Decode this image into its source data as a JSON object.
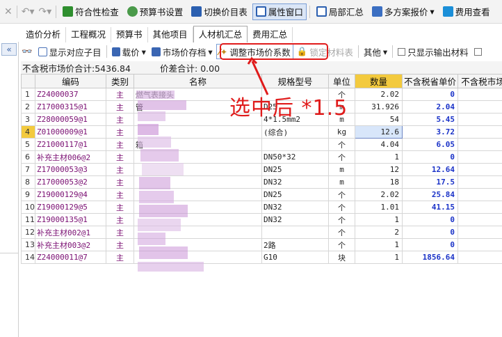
{
  "toolbar": {
    "items": [
      {
        "label": "符合性检查",
        "icon": "grid-check-icon",
        "color": "#2f8f2f"
      },
      {
        "label": "预算书设置",
        "icon": "gear-icon",
        "color": "#3a7a3a"
      },
      {
        "label": "切换价目表",
        "icon": "switch-icon",
        "color": "#2b5fb0"
      },
      {
        "label": "属性窗口",
        "icon": "window-icon",
        "color": "#2b5fb0",
        "active": true
      },
      {
        "label": "局部汇总",
        "icon": "summary-icon",
        "color": "#2b5fb0"
      },
      {
        "label": "多方案报价",
        "icon": "scheme-icon",
        "color": "#2b5fb0"
      },
      {
        "label": "费用查看",
        "icon": "cost-view-icon",
        "color": "#1b8fd8"
      }
    ]
  },
  "tabs": [
    "造价分析",
    "工程概况",
    "预算书",
    "其他项目",
    "人材机汇总",
    "费用汇总"
  ],
  "active_tab": "人材机汇总",
  "subtoolbar": {
    "show_child": "显示对应子目",
    "load_price": "载价",
    "market_price_file": "市场价存档",
    "adjust_coef": "调整市场价系数",
    "lock_material": "锁定材料表",
    "other": "其他",
    "only_output": "只显示输出材料"
  },
  "summary": {
    "label1": "不含税市场价合计:",
    "value1": "5436.84",
    "label2": "价差合计:",
    "value2": "0.00"
  },
  "columns": [
    "编码",
    "类别",
    "名称",
    "规格型号",
    "单位",
    "数量",
    "不含税省单价",
    "不含税市场"
  ],
  "rows": [
    {
      "idx": "1",
      "code": "Z24000037",
      "kind": "主",
      "name": "燃气表接头",
      "spec": "",
      "unit": "个",
      "qty": "2.02",
      "price": "0"
    },
    {
      "idx": "2",
      "code": "Z17000315@1",
      "kind": "主",
      "name": "管",
      "spec": "D25",
      "unit": "m",
      "qty": "31.926",
      "price": "2.04"
    },
    {
      "idx": "3",
      "code": "Z28000059@1",
      "kind": "主",
      "name": "",
      "spec": "4*1.5mm2",
      "unit": "m",
      "qty": "54",
      "price": "5.45"
    },
    {
      "idx": "4",
      "code": "Z01000009@1",
      "kind": "主",
      "name": "",
      "spec": "(综合)",
      "unit": "kg",
      "qty": "12.6",
      "price": "3.72",
      "selected": true
    },
    {
      "idx": "5",
      "code": "Z21000117@1",
      "kind": "主",
      "name": "箱",
      "spec": "",
      "unit": "个",
      "qty": "4.04",
      "price": "6.05"
    },
    {
      "idx": "6",
      "code": "补充主材006@2",
      "kind": "主",
      "name": "",
      "spec": "DN50*32",
      "unit": "个",
      "qty": "1",
      "price": "0"
    },
    {
      "idx": "7",
      "code": "Z17000053@3",
      "kind": "主",
      "name": "",
      "spec": "DN25",
      "unit": "m",
      "qty": "12",
      "price": "12.64"
    },
    {
      "idx": "8",
      "code": "Z17000053@2",
      "kind": "主",
      "name": "",
      "spec": "DN32",
      "unit": "m",
      "qty": "18",
      "price": "17.5"
    },
    {
      "idx": "9",
      "code": "Z19000129@4",
      "kind": "主",
      "name": "",
      "spec": "DN25",
      "unit": "个",
      "qty": "2.02",
      "price": "25.84"
    },
    {
      "idx": "10",
      "code": "Z19000129@5",
      "kind": "主",
      "name": "",
      "spec": "DN32",
      "unit": "个",
      "qty": "1.01",
      "price": "41.15"
    },
    {
      "idx": "11",
      "code": "Z19000135@1",
      "kind": "主",
      "name": "",
      "spec": "DN32",
      "unit": "个",
      "qty": "1",
      "price": "0"
    },
    {
      "idx": "12",
      "code": "补充主材002@1",
      "kind": "主",
      "name": "",
      "spec": "",
      "unit": "个",
      "qty": "2",
      "price": "0"
    },
    {
      "idx": "13",
      "code": "补充主材003@2",
      "kind": "主",
      "name": "",
      "spec": "2路",
      "unit": "个",
      "qty": "1",
      "price": "0"
    },
    {
      "idx": "14",
      "code": "Z24000011@7",
      "kind": "主",
      "name": "",
      "spec": "G10",
      "unit": "块",
      "qty": "1",
      "price": "1856.64"
    }
  ],
  "annotation": "选中后 *1.5",
  "colors": {
    "accent": "#7a9ed6",
    "highlight": "#f3ca3e",
    "annotation": "#e01b1b",
    "price": "#1b33c8",
    "code": "#7a0e72"
  }
}
